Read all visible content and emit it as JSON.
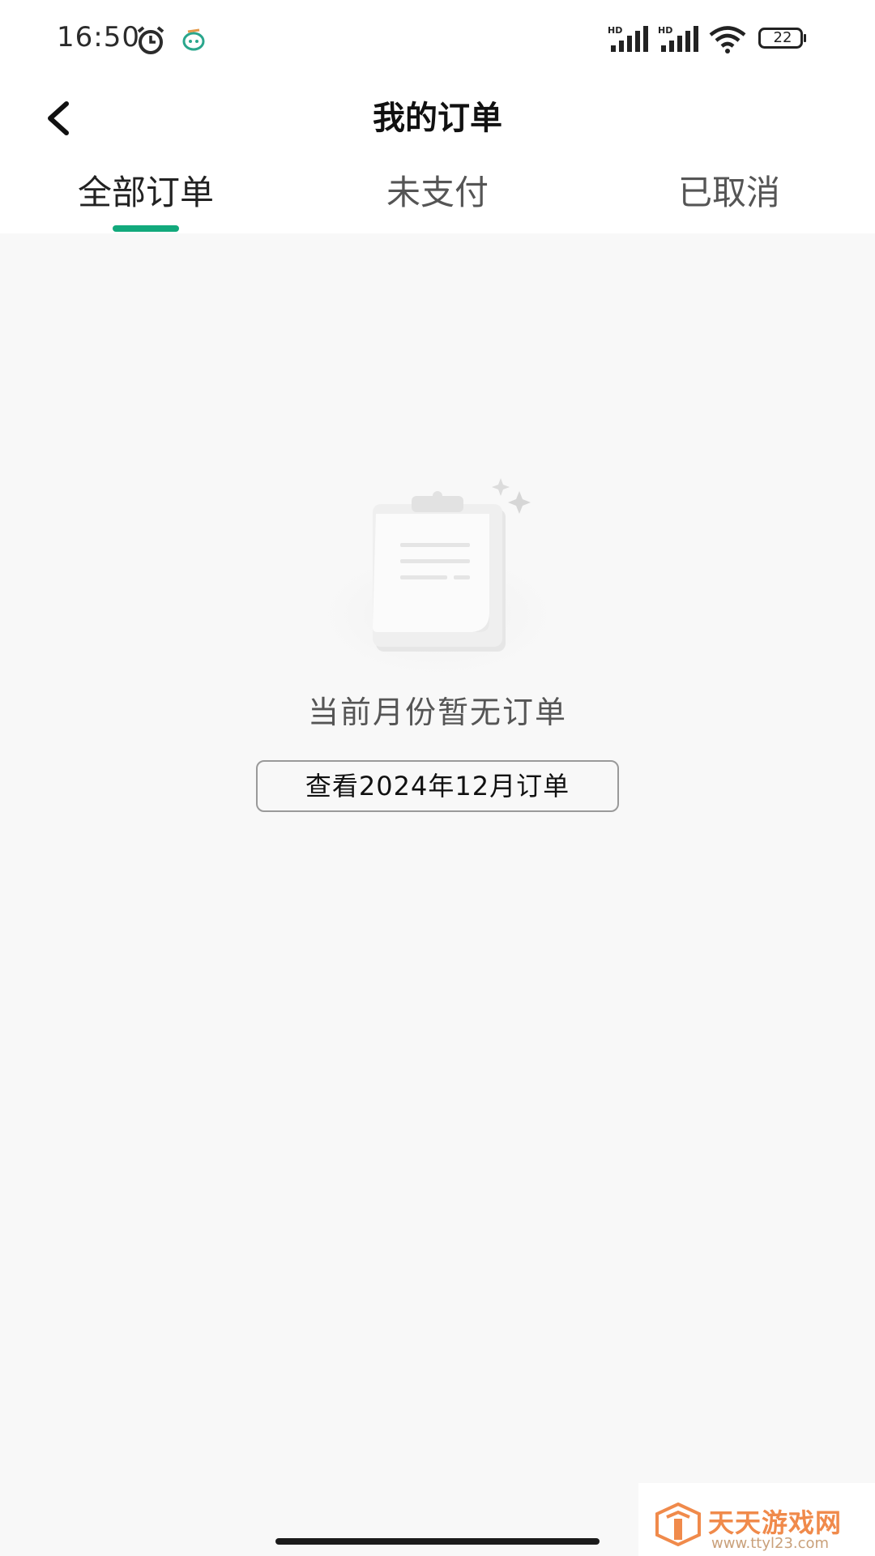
{
  "status_bar": {
    "time": "16:50",
    "battery_level": "22",
    "signal_label_1": "HD",
    "signal_label_2": "HD"
  },
  "header": {
    "title": "我的订单"
  },
  "tabs": [
    {
      "label": "全部订单",
      "active": true
    },
    {
      "label": "未支付",
      "active": false
    },
    {
      "label": "已取消",
      "active": false
    }
  ],
  "empty_state": {
    "message": "当前月份暂无订单",
    "button_label": "查看2024年12月订单"
  },
  "watermark": {
    "name": "天天游戏网",
    "url": "www.ttyl23.com"
  },
  "colors": {
    "accent": "#12a97c",
    "background": "#f8f8f8",
    "watermark": "#f08a4b"
  }
}
